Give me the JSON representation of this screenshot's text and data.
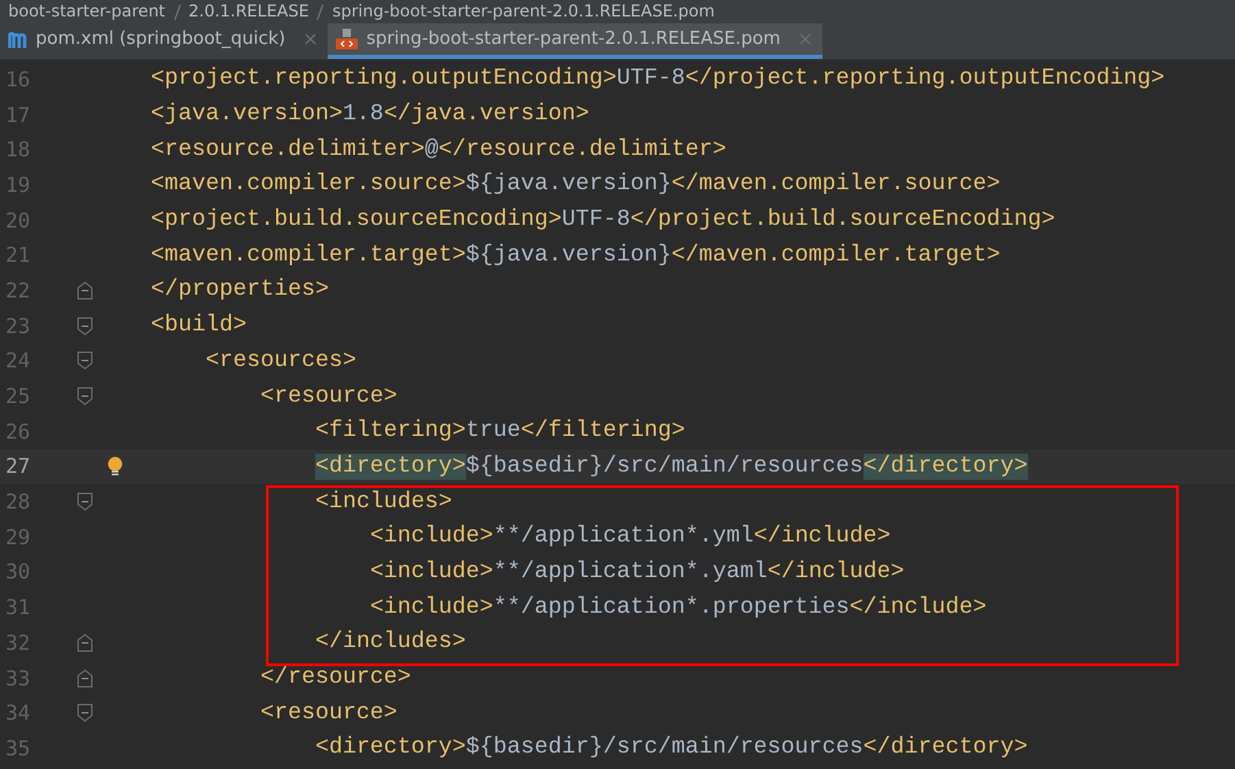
{
  "breadcrumbs": [
    "boot-starter-parent",
    "2.0.1.RELEASE",
    "spring-boot-starter-parent-2.0.1.RELEASE.pom"
  ],
  "tabs": [
    {
      "label": "pom.xml (springboot_quick)",
      "kind": "maven",
      "selected": false
    },
    {
      "label": "spring-boot-starter-parent-2.0.1.RELEASE.pom",
      "kind": "xml",
      "selected": true
    }
  ],
  "editor": {
    "lines": [
      {
        "number": "16",
        "kind": "plain",
        "code": "    <project.reporting.outputEncoding>UTF-8</project.reporting.outputEncoding>"
      },
      {
        "number": "17",
        "kind": "plain",
        "code": "    <java.version>1.8</java.version>"
      },
      {
        "number": "18",
        "kind": "plain",
        "code": "    <resource.delimiter>@</resource.delimiter>"
      },
      {
        "number": "19",
        "kind": "plain",
        "code": "    <maven.compiler.source>${java.version}</maven.compiler.source>"
      },
      {
        "number": "20",
        "kind": "plain",
        "code": "    <project.build.sourceEncoding>UTF-8</project.build.sourceEncoding>"
      },
      {
        "number": "21",
        "kind": "plain",
        "code": "    <maven.compiler.target>${java.version}</maven.compiler.target>"
      },
      {
        "number": "22",
        "kind": "closer",
        "code": "</properties>"
      },
      {
        "number": "23",
        "kind": "opener",
        "code": "<build>"
      },
      {
        "number": "24",
        "kind": "opener",
        "code": "        <resources>"
      },
      {
        "number": "25",
        "kind": "opener",
        "code": "            <resource>"
      },
      {
        "number": "26",
        "kind": "plain",
        "code": "                <filtering>true</filtering>"
      },
      {
        "number": "27",
        "kind": "plain",
        "code": "                <directory>${basedir}/src/main/resources</directory>",
        "current": true,
        "bulb": true
      },
      {
        "number": "28",
        "kind": "opener",
        "code": "                <includes>",
        "boxed": true
      },
      {
        "number": "29",
        "kind": "plain",
        "code": "                    <include>**/application*.yml</include>",
        "boxed": true
      },
      {
        "number": "30",
        "kind": "plain",
        "code": "                    <include>**/application*.yaml</include>",
        "boxed": true
      },
      {
        "number": "31",
        "kind": "plain",
        "code": "                    <include>**/application*.properties</include>",
        "boxed": true
      },
      {
        "number": "32",
        "kind": "closer",
        "code": "                </includes>",
        "boxed": true
      },
      {
        "number": "33",
        "kind": "closer",
        "code": "            </resource>"
      },
      {
        "number": "34",
        "kind": "opener",
        "code": "            <resource>"
      },
      {
        "number": "35",
        "kind": "plain",
        "code": "                <directory>${basedir}/src/main/resources</directory>"
      }
    ]
  }
}
